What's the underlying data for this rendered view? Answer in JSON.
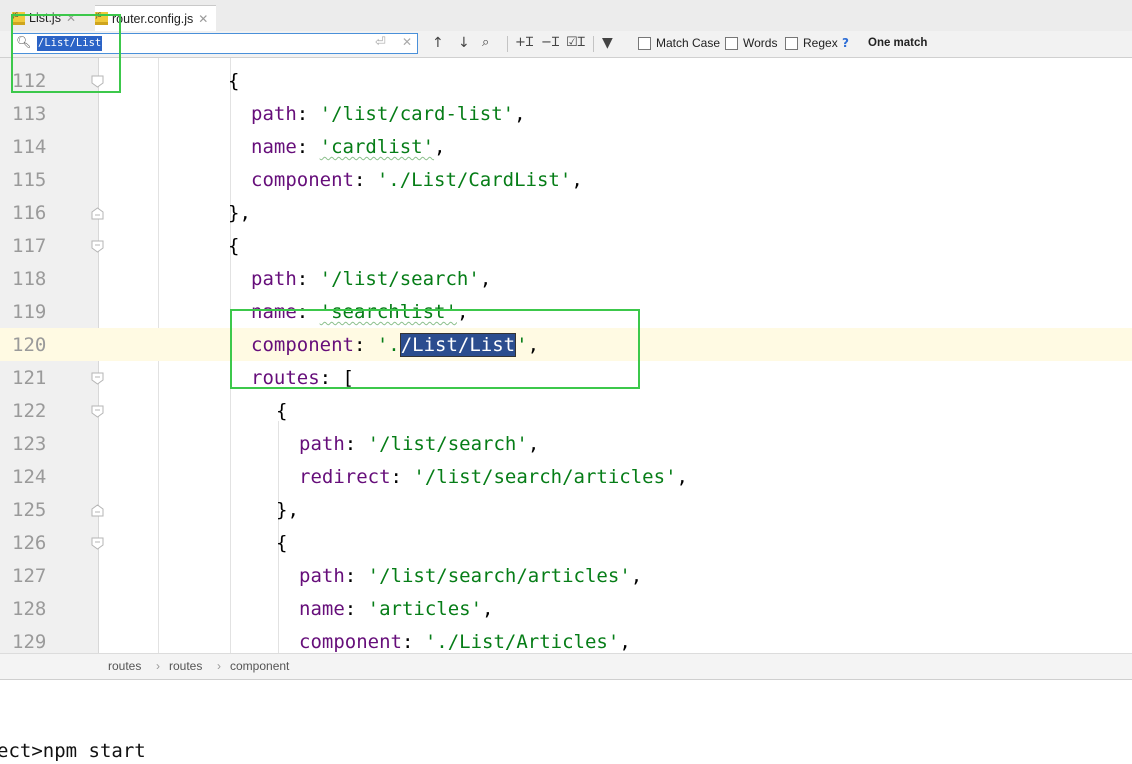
{
  "tabs": [
    {
      "icon": "js-file-icon",
      "label": "List.js"
    },
    {
      "icon": "js-file-icon",
      "label": "router.config.js"
    }
  ],
  "find": {
    "query": "/List/List",
    "options": [
      "Match Case",
      "Words",
      "Regex"
    ],
    "help": "?",
    "result": "One match"
  },
  "editor": {
    "current_line": 120,
    "lines": [
      {
        "no": "112",
        "text": "{"
      },
      {
        "no": "113",
        "key": "path",
        "value": "'/list/card-list'"
      },
      {
        "no": "114",
        "key": "name",
        "value": "'cardlist'"
      },
      {
        "no": "115",
        "key": "component",
        "value": "'./List/CardList'"
      },
      {
        "no": "116",
        "text": "},"
      },
      {
        "no": "117",
        "text": "{"
      },
      {
        "no": "118",
        "key": "path",
        "value": "'/list/search'"
      },
      {
        "no": "119",
        "key": "name",
        "value": "'searchlist'"
      },
      {
        "no": "120",
        "key": "component",
        "value_pre": "'.",
        "value_match": "/List/List",
        "value_post": "'"
      },
      {
        "no": "121",
        "key": "routes",
        "text": "["
      },
      {
        "no": "122",
        "text": "{"
      },
      {
        "no": "123",
        "key": "path",
        "value": "'/list/search'"
      },
      {
        "no": "124",
        "key": "redirect",
        "value": "'/list/search/articles'"
      },
      {
        "no": "125",
        "text": "},"
      },
      {
        "no": "126",
        "text": "{"
      },
      {
        "no": "127",
        "key": "path",
        "value": "'/list/search/articles'"
      },
      {
        "no": "128",
        "key": "name",
        "value": "'articles'"
      },
      {
        "no": "129",
        "key": "component",
        "value": "'./List/Articles'"
      }
    ]
  },
  "breadcrumb": [
    "routes",
    "routes",
    "component"
  ],
  "terminal": {
    "text": "ect>npm start"
  },
  "colors": {
    "keyword": "#660e7a",
    "string": "#067d17",
    "annotation": "#3cc84b",
    "match_highlight": "#2b4d8f"
  }
}
